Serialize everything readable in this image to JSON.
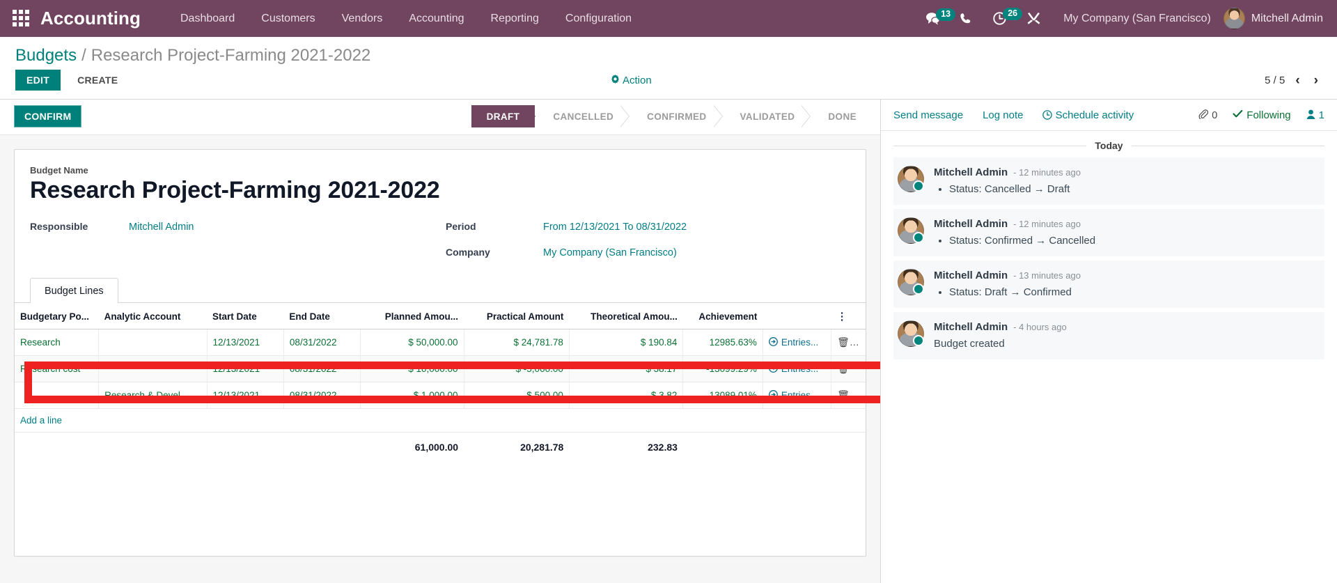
{
  "navbar": {
    "apps_icon": "apps-grid-icon",
    "brand": "Accounting",
    "menus": [
      "Dashboard",
      "Customers",
      "Vendors",
      "Accounting",
      "Reporting",
      "Configuration"
    ],
    "messages_badge": "13",
    "activities_badge": "26",
    "company": "My Company (San Francisco)",
    "user": "Mitchell Admin"
  },
  "control_panel": {
    "breadcrumb_root": "Budgets",
    "breadcrumb_sep": "/",
    "breadcrumb_current": "Research Project-Farming 2021-2022",
    "edit_label": "EDIT",
    "create_label": "CREATE",
    "action_label": "Action",
    "pager_value": "5 / 5",
    "prev_glyph": "‹",
    "next_glyph": "›"
  },
  "statusbar": {
    "confirm_label": "CONFIRM",
    "stages": [
      "DRAFT",
      "CANCELLED",
      "CONFIRMED",
      "VALIDATED",
      "DONE"
    ],
    "active_stage": "DRAFT"
  },
  "form": {
    "budget_name_label": "Budget Name",
    "budget_name_value": "Research Project-Farming 2021-2022",
    "responsible_label": "Responsible",
    "responsible_value": "Mitchell Admin",
    "period_label": "Period",
    "period_value": "From 12/13/2021 To 08/31/2022",
    "company_label": "Company",
    "company_value": "My Company (San Francisco)",
    "tab_label": "Budget Lines",
    "add_line_label": "Add a line"
  },
  "table": {
    "headers": [
      "Budgetary Po...",
      "Analytic Account",
      "Start Date",
      "End Date",
      "Planned Amou...",
      "Practical Amount",
      "Theoretical Amou...",
      "Achievement"
    ],
    "optional_cols_icon": "vertical-dots-icon",
    "entries_label": "Entries...",
    "trash_icon": "trash-icon",
    "rows": [
      {
        "budgetary_position": "Research",
        "analytic_account": "",
        "start_date": "12/13/2021",
        "end_date": "08/31/2022",
        "planned_amount": "$ 50,000.00",
        "practical_amount": "$ 24,781.78",
        "theoretical_amount": "$ 190.84",
        "achievement": "12985.63%",
        "highlighted": false
      },
      {
        "budgetary_position": "Research cost",
        "analytic_account": "",
        "start_date": "12/13/2021",
        "end_date": "08/31/2022",
        "planned_amount": "$ 10,000.00",
        "practical_amount": "$ -5,000.00",
        "theoretical_amount": "$ 38.17",
        "achievement": "-13099.29%",
        "highlighted": false
      },
      {
        "budgetary_position": "",
        "analytic_account": "Research & Devel...",
        "start_date": "12/13/2021",
        "end_date": "08/31/2022",
        "planned_amount": "$ 1,000.00",
        "practical_amount": "$ 500.00",
        "theoretical_amount": "$ 3.82",
        "achievement": "13089.01%",
        "highlighted": true
      }
    ],
    "totals": {
      "planned_amount": "61,000.00",
      "practical_amount": "20,281.78",
      "theoretical_amount": "232.83"
    }
  },
  "chatter": {
    "send_message": "Send message",
    "log_note": "Log note",
    "schedule_activity": "Schedule activity",
    "attachment_count": "0",
    "following_label": "Following",
    "follower_count": "1",
    "day_separator": "Today",
    "messages": [
      {
        "author": "Mitchell Admin",
        "time": "- 12 minutes ago",
        "body": "Status: Cancelled → Draft",
        "bulleted": true
      },
      {
        "author": "Mitchell Admin",
        "time": "- 12 minutes ago",
        "body": "Status: Confirmed → Cancelled",
        "bulleted": true
      },
      {
        "author": "Mitchell Admin",
        "time": "- 13 minutes ago",
        "body": "Status: Draft → Confirmed",
        "bulleted": true
      },
      {
        "author": "Mitchell Admin",
        "time": "- 4 hours ago",
        "body": "Budget created",
        "bulleted": false
      }
    ]
  },
  "colors": {
    "brand_purple": "#71445f",
    "accent_teal": "#00807b",
    "highlight_red": "#ef2222",
    "money_green": "#0b7035"
  }
}
